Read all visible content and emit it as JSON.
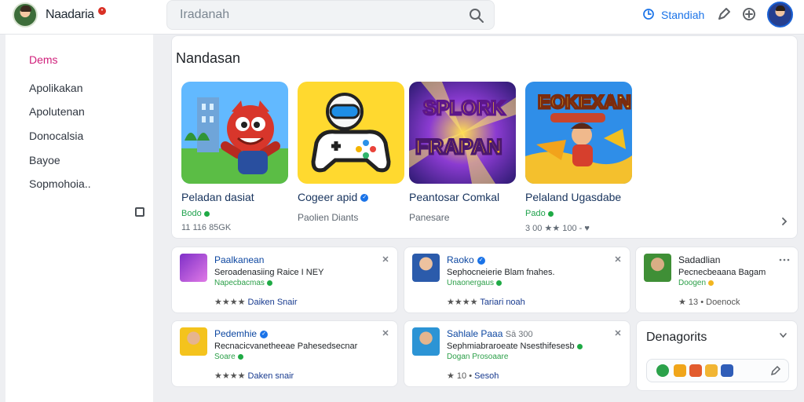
{
  "header": {
    "brand_name": "Naadaria",
    "brand_badge": "•",
    "search_placeholder": "Iradanah",
    "top_link": "Standiah",
    "icons": [
      "search-icon",
      "clock-icon",
      "pen-icon",
      "plus-icon"
    ]
  },
  "sidebar": {
    "items": [
      {
        "label": "Dems",
        "active": true
      },
      {
        "label": "Apolikakan",
        "active": false
      },
      {
        "label": "Apolutenan",
        "active": false
      },
      {
        "label": "Donocalsia",
        "active": false
      },
      {
        "label": "Bayoe",
        "active": false
      },
      {
        "label": "Sopmohoia..",
        "active": false
      }
    ]
  },
  "featured": {
    "title": "Nandasan",
    "cards": [
      {
        "title": "Peladan dasiat",
        "subtitle": "Bodo",
        "meta": "11 116 85GK",
        "art_name": "game-art-hero"
      },
      {
        "title": "Cogeer apid",
        "subtitle": "",
        "meta": "Paolien Diants",
        "art_name": "game-art-controller"
      },
      {
        "title": "Peantosar Comkal",
        "subtitle": "",
        "meta": "Panesare",
        "art_name": "game-art-splork"
      },
      {
        "title": "Pelaland Ugasdabe",
        "subtitle": "Pado",
        "meta": "3 00 ★★ 100 -",
        "art_name": "game-art-adventure"
      }
    ]
  },
  "recommendations": [
    {
      "title": "Paalkanean",
      "desc": "Seroadenasiing Raice I NEY",
      "tag": "Napecbacmas",
      "rating": "★★★★",
      "rating_link": "Daiken Snair"
    },
    {
      "title": "Raoko",
      "desc": "Sephocneierie Blam fnahes.",
      "tag": "Unaonergaus",
      "rating": "★★★★",
      "rating_link": "Tariari noah"
    },
    {
      "title": "Sadadlian",
      "desc": "Pecnecbeaana Bagam",
      "tag": "Doogen",
      "rating": "★ 13 •",
      "rating_link": "Doenock"
    },
    {
      "title": "Pedemhie",
      "desc": "Recnacicvanetheeae Pahesedsecnar",
      "tag": "Soare",
      "rating": "★★★★",
      "rating_link": "Daken snair"
    },
    {
      "title": "Sahlale Paaa",
      "title_extra": "Sā 300",
      "desc": "Sephmiabraroeate Nsesthifesesb",
      "tag": "Dogan Prosoaare",
      "rating": "★ 10 •",
      "rating_link": "Sesoh"
    }
  ],
  "categories": {
    "title": "Denagorits",
    "chip_colors": [
      "#2aa14a",
      "#f0a51a",
      "#e25b2d",
      "#f1b533",
      "#2f5db8"
    ]
  },
  "colors": {
    "accent_blue": "#1a73e8",
    "active_pink": "#d0207b",
    "green": "#1faa45"
  }
}
